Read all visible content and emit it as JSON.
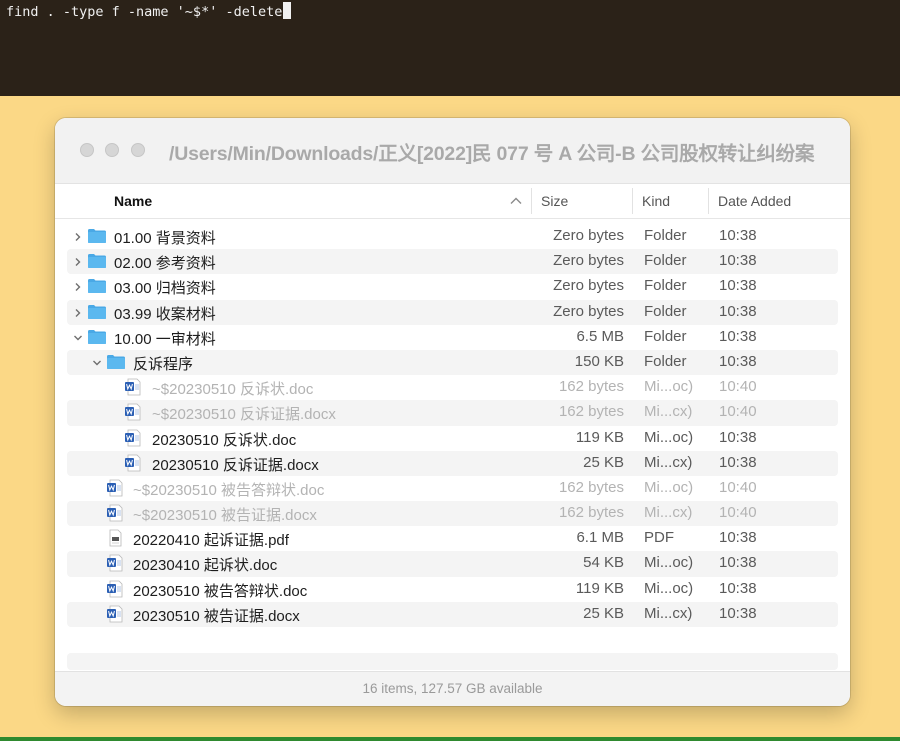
{
  "terminal": {
    "command": "find . -type f -name '~$*' -delete"
  },
  "window": {
    "title": "/Users/Min/Downloads/正义[2022]民 077 号 A 公司-B 公司股权转让纠纷案",
    "status": "16 items, 127.57 GB available"
  },
  "columns": {
    "name": "Name",
    "size": "Size",
    "kind": "Kind",
    "date": "Date Added"
  },
  "icons": {
    "folder": "folder-icon",
    "word": "word-document-icon",
    "pdf": "pdf-document-icon",
    "disclosure": "chevron-icon",
    "sort": "sort-ascending-icon"
  },
  "colors": {
    "folder": "#5bb8ef",
    "word": "#2b5fb4",
    "terminal_bg": "#2b2218",
    "desktop_bg": "#fbd886"
  },
  "files": [
    {
      "name": "01.00 背景资料",
      "size": "Zero bytes",
      "kind": "Folder",
      "date": "10:38",
      "level": 0,
      "type": "folder",
      "expanded": false,
      "dim": false
    },
    {
      "name": "02.00 参考资料",
      "size": "Zero bytes",
      "kind": "Folder",
      "date": "10:38",
      "level": 0,
      "type": "folder",
      "expanded": false,
      "dim": false
    },
    {
      "name": "03.00 归档资料",
      "size": "Zero bytes",
      "kind": "Folder",
      "date": "10:38",
      "level": 0,
      "type": "folder",
      "expanded": false,
      "dim": false
    },
    {
      "name": "03.99 收案材料",
      "size": "Zero bytes",
      "kind": "Folder",
      "date": "10:38",
      "level": 0,
      "type": "folder",
      "expanded": false,
      "dim": false
    },
    {
      "name": "10.00 一审材料",
      "size": "6.5 MB",
      "kind": "Folder",
      "date": "10:38",
      "level": 0,
      "type": "folder",
      "expanded": true,
      "dim": false
    },
    {
      "name": "反诉程序",
      "size": "150 KB",
      "kind": "Folder",
      "date": "10:38",
      "level": 1,
      "type": "folder",
      "expanded": true,
      "dim": false
    },
    {
      "name": "~$20230510 反诉状.doc",
      "size": "162 bytes",
      "kind": "Mi...oc)",
      "date": "10:40",
      "level": 2,
      "type": "word",
      "dim": true
    },
    {
      "name": "~$20230510 反诉证据.docx",
      "size": "162 bytes",
      "kind": "Mi...cx)",
      "date": "10:40",
      "level": 2,
      "type": "word",
      "dim": true
    },
    {
      "name": "20230510 反诉状.doc",
      "size": "119 KB",
      "kind": "Mi...oc)",
      "date": "10:38",
      "level": 2,
      "type": "word",
      "dim": false
    },
    {
      "name": "20230510 反诉证据.docx",
      "size": "25 KB",
      "kind": "Mi...cx)",
      "date": "10:38",
      "level": 2,
      "type": "word",
      "dim": false
    },
    {
      "name": "~$20230510 被告答辩状.doc",
      "size": "162 bytes",
      "kind": "Mi...oc)",
      "date": "10:40",
      "level": 1,
      "type": "word",
      "dim": true
    },
    {
      "name": "~$20230510 被告证据.docx",
      "size": "162 bytes",
      "kind": "Mi...cx)",
      "date": "10:40",
      "level": 1,
      "type": "word",
      "dim": true
    },
    {
      "name": "20220410 起诉证据.pdf",
      "size": "6.1 MB",
      "kind": "PDF",
      "date": "10:38",
      "level": 1,
      "type": "pdf",
      "dim": false
    },
    {
      "name": "20230410 起诉状.doc",
      "size": "54 KB",
      "kind": "Mi...oc)",
      "date": "10:38",
      "level": 1,
      "type": "word",
      "dim": false
    },
    {
      "name": "20230510 被告答辩状.doc",
      "size": "119 KB",
      "kind": "Mi...oc)",
      "date": "10:38",
      "level": 1,
      "type": "word",
      "dim": false
    },
    {
      "name": "20230510 被告证据.docx",
      "size": "25 KB",
      "kind": "Mi...cx)",
      "date": "10:38",
      "level": 1,
      "type": "word",
      "dim": false
    }
  ]
}
